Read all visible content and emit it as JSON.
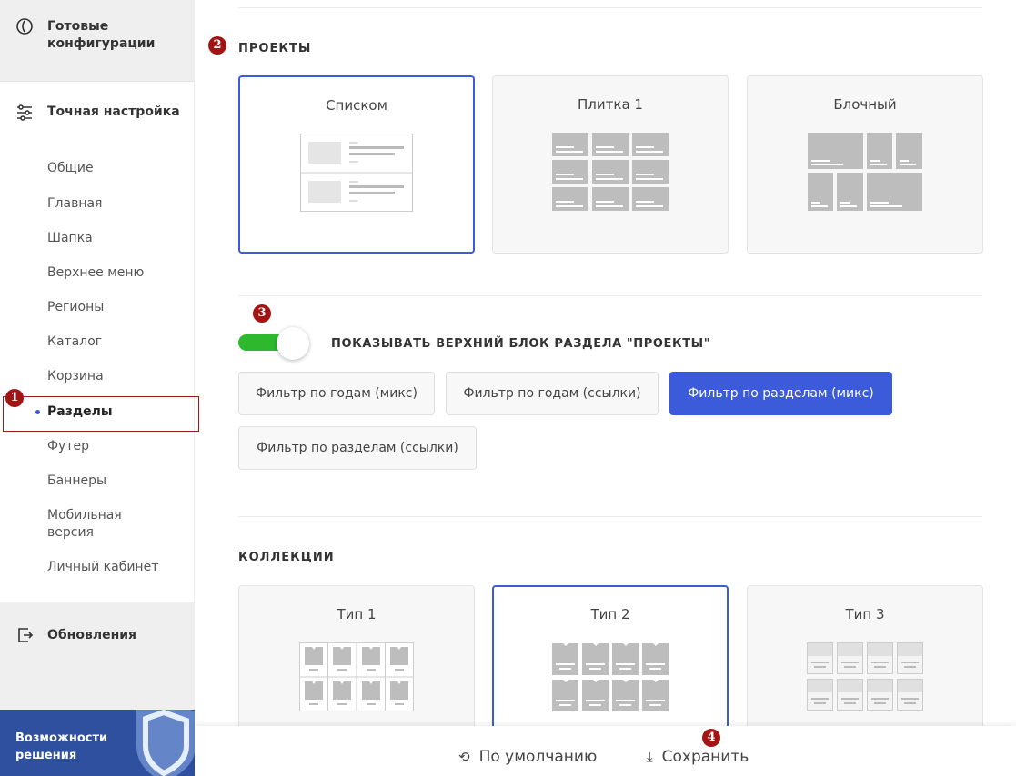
{
  "sidebar": {
    "ready_configs": "Готовые конфигурации",
    "fine_tune": "Точная настройка",
    "items": [
      "Общие",
      "Главная",
      "Шапка",
      "Верхнее меню",
      "Регионы",
      "Каталог",
      "Корзина",
      "Разделы",
      "Футер",
      "Баннеры",
      "Мобильная версия",
      "Личный кабинет"
    ],
    "updates": "Обновления",
    "banner_text": "Возможности решения"
  },
  "badges": [
    "1",
    "2",
    "3",
    "4"
  ],
  "projects": {
    "title": "ПРОЕКТЫ",
    "options": [
      "Списком",
      "Плитка 1",
      "Блочный"
    ],
    "selected": "Списком"
  },
  "toggle": {
    "label": "ПОКАЗЫВАТЬ ВЕРХНИЙ БЛОК РАЗДЕЛА \"ПРОЕКТЫ\"",
    "on": true
  },
  "filters": {
    "buttons": [
      "Фильтр по годам (микс)",
      "Фильтр по годам (ссылки)",
      "Фильтр по разделам (микс)",
      "Фильтр по разделам (ссылки)"
    ],
    "active": "Фильтр по разделам (микс)"
  },
  "collections": {
    "title": "КОЛЛЕКЦИИ",
    "options": [
      "Тип 1",
      "Тип 2",
      "Тип 3"
    ],
    "selected": "Тип 2"
  },
  "footer": {
    "default_label": "По умолчанию",
    "save_label": "Сохранить"
  },
  "colors": {
    "accent": "#3b5bdb",
    "toggle_on": "#2eb82e",
    "badge": "#a31515"
  }
}
